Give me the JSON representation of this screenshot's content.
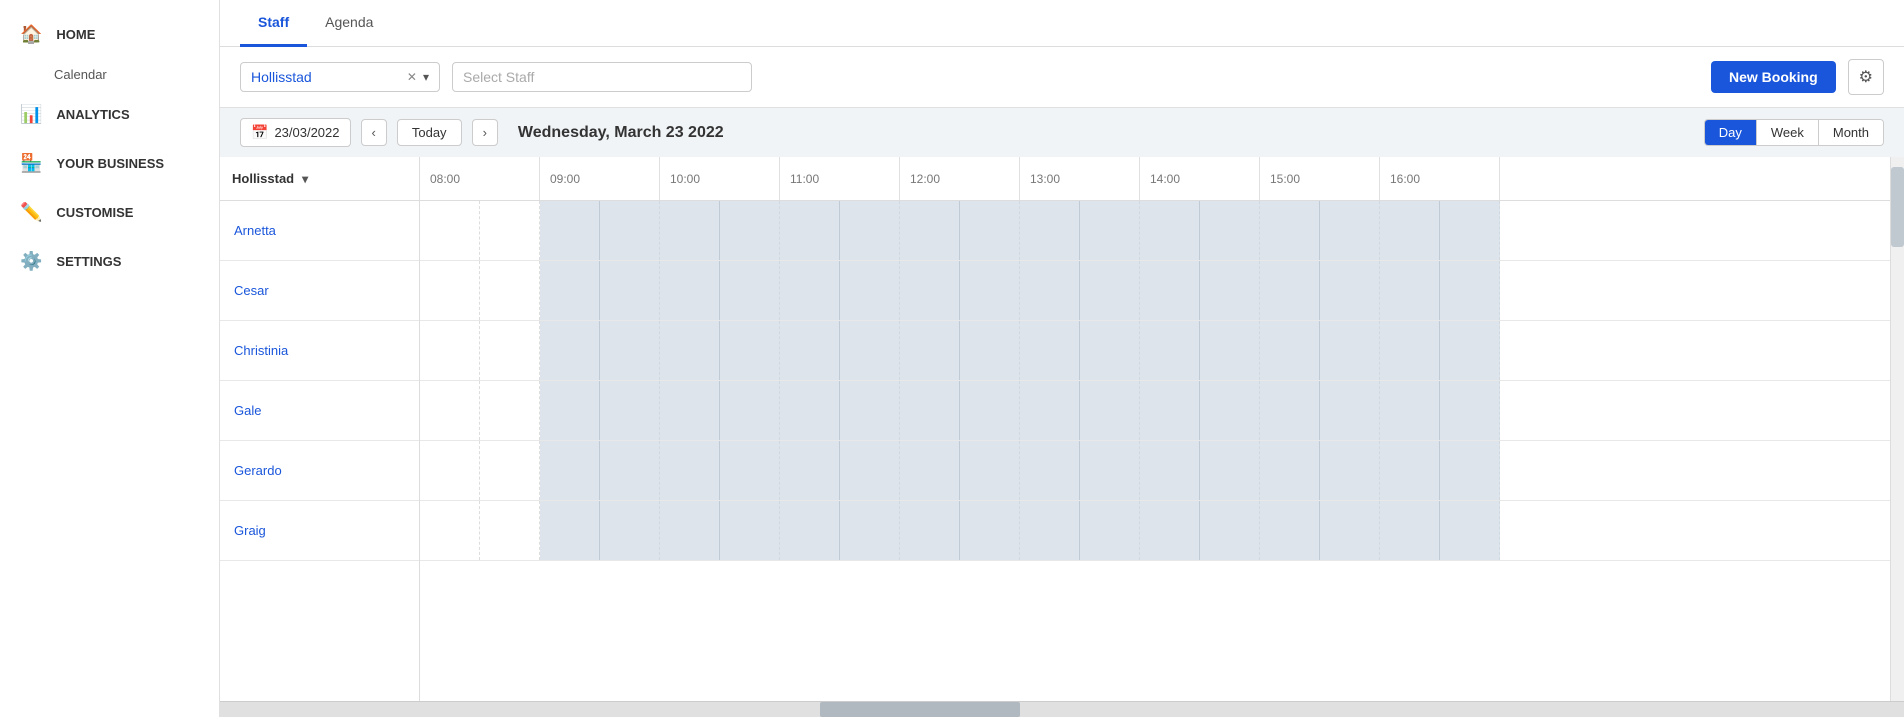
{
  "sidebar": {
    "items": [
      {
        "id": "home",
        "label": "HOME",
        "icon": "🏠"
      },
      {
        "id": "calendar",
        "label": "Calendar",
        "sub": true
      },
      {
        "id": "analytics",
        "label": "ANALYTICS",
        "icon": "📊"
      },
      {
        "id": "your-business",
        "label": "YOUR BUSINESS",
        "icon": "🏪"
      },
      {
        "id": "customise",
        "label": "CUSTOMISE",
        "icon": "✏️"
      },
      {
        "id": "settings",
        "label": "SETTINGS",
        "icon": "⚙️"
      }
    ]
  },
  "tabs": [
    {
      "id": "staff",
      "label": "Staff",
      "active": true
    },
    {
      "id": "agenda",
      "label": "Agenda",
      "active": false
    }
  ],
  "toolbar": {
    "location_value": "Hollisstad",
    "staff_placeholder": "Select Staff",
    "new_booking_label": "New Booking"
  },
  "date_nav": {
    "date_value": "23/03/2022",
    "today_label": "Today",
    "current_date": "Wednesday, March 23 2022",
    "views": [
      "Day",
      "Week",
      "Month"
    ],
    "active_view": "Day"
  },
  "calendar": {
    "location_name": "Hollisstad",
    "staff": [
      {
        "name": "Arnetta"
      },
      {
        "name": "Cesar"
      },
      {
        "name": "Christinia"
      },
      {
        "name": "Gale"
      },
      {
        "name": "Gerardo"
      },
      {
        "name": "Graig"
      }
    ],
    "hours": [
      "08:00",
      "09:00",
      "10:00",
      "11:00",
      "12:00",
      "13:00",
      "14:00",
      "15:00",
      "16:00"
    ]
  }
}
